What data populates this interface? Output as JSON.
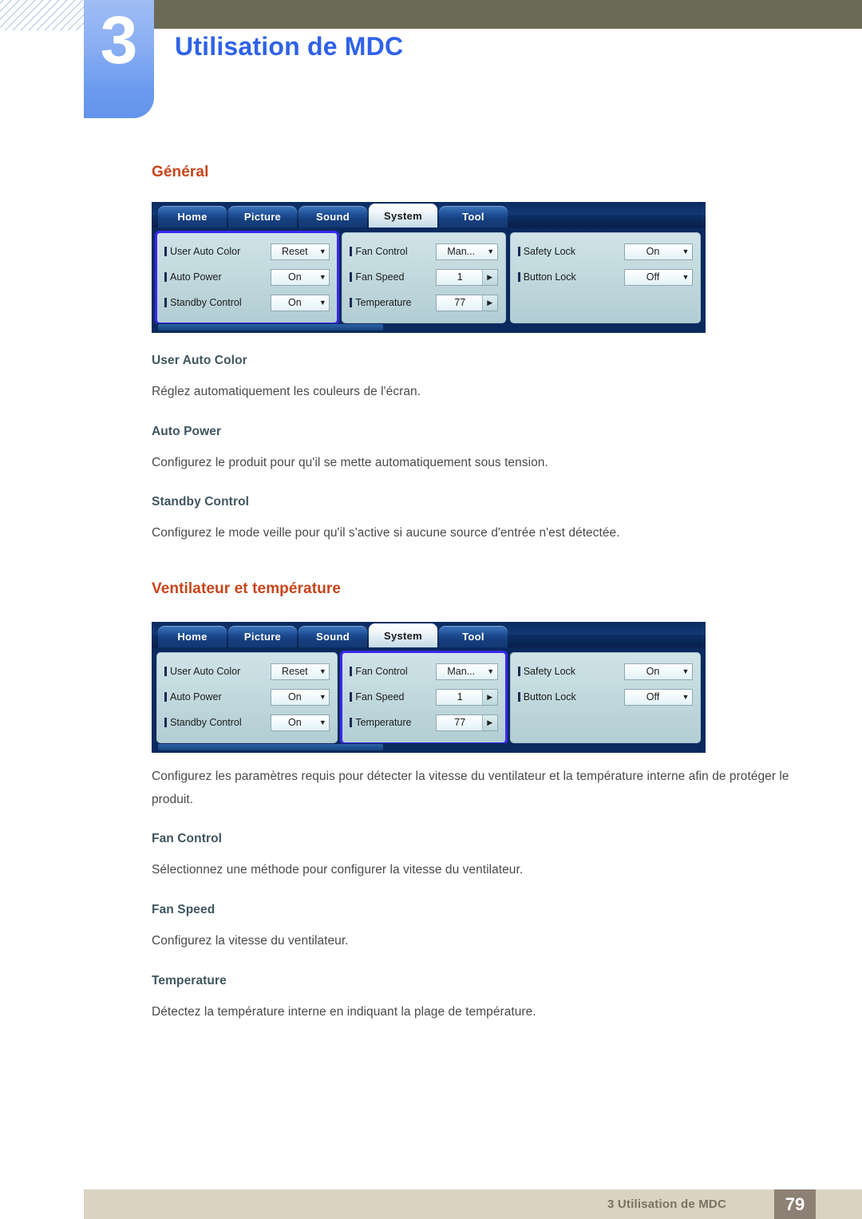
{
  "header": {
    "chapter_number": "3",
    "chapter_title": "Utilisation de MDC"
  },
  "sections": [
    {
      "heading": "Général",
      "items": [
        {
          "title": "User Auto Color",
          "text": "Réglez automatiquement les couleurs de l'écran."
        },
        {
          "title": "Auto Power",
          "text": "Configurez le produit pour qu'il se mette automatiquement sous tension."
        },
        {
          "title": "Standby Control",
          "text": "Configurez le mode veille pour qu'il s'active si aucune source d'entrée n'est détectée."
        }
      ]
    },
    {
      "heading": "Ventilateur et température",
      "intro": "Configurez les paramètres requis pour détecter la vitesse du ventilateur et la température interne afin de protéger le produit.",
      "items": [
        {
          "title": "Fan Control",
          "text": "Sélectionnez une méthode pour configurer la vitesse du ventilateur."
        },
        {
          "title": "Fan Speed",
          "text": "Configurez la vitesse du ventilateur."
        },
        {
          "title": "Temperature",
          "text": "Détectez la température interne en indiquant la plage de température."
        }
      ]
    }
  ],
  "mdc": {
    "tabs": [
      {
        "label": "Home",
        "active": false
      },
      {
        "label": "Picture",
        "active": false
      },
      {
        "label": "Sound",
        "active": false
      },
      {
        "label": "System",
        "active": true
      },
      {
        "label": "Tool",
        "active": false
      }
    ],
    "panel_general": {
      "rows": [
        {
          "label": "User Auto Color",
          "value": "Reset",
          "control": "dropdown"
        },
        {
          "label": "Auto Power",
          "value": "On",
          "control": "dropdown"
        },
        {
          "label": "Standby Control",
          "value": "On",
          "control": "dropdown"
        }
      ]
    },
    "panel_fan": {
      "rows": [
        {
          "label": "Fan Control",
          "value": "Man...",
          "control": "dropdown"
        },
        {
          "label": "Fan Speed",
          "value": "1",
          "control": "spinner"
        },
        {
          "label": "Temperature",
          "value": "77",
          "control": "spinner"
        }
      ]
    },
    "panel_lock": {
      "rows": [
        {
          "label": "Safety Lock",
          "value": "On",
          "control": "dropdown"
        },
        {
          "label": "Button Lock",
          "value": "Off",
          "control": "dropdown"
        }
      ]
    },
    "highlight_shot1": "panel_general",
    "highlight_shot2": "panel_fan"
  },
  "footer": {
    "text": "3 Utilisation de MDC",
    "page": "79"
  },
  "colors": {
    "header_band": "#6b6a55",
    "chapter_tab": "#6c9bee",
    "chapter_title": "#2f62e8",
    "section_heading": "#c8441b",
    "sub_heading": "#3f5560",
    "body_text": "#4a4a4a",
    "footer_band": "#d9d3c0",
    "footer_page_box": "#8d8074",
    "mdc_highlight": "#3b27f0"
  }
}
